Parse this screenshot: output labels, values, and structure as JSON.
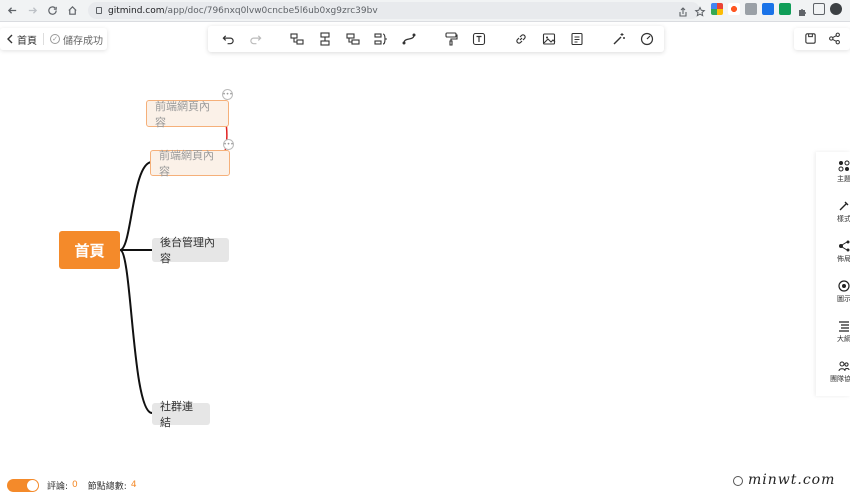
{
  "browser": {
    "url_host": "gitmind.com",
    "url_path": "/app/doc/796nxq0lvw0cncbe5l6ub0xg9zrc39bv"
  },
  "header": {
    "back_label": "首頁",
    "saved_label": "儲存成功"
  },
  "toolbar": {
    "icons": [
      "undo-icon",
      "redo-icon",
      "add-child-icon",
      "add-sibling-icon",
      "add-parent-icon",
      "summary-icon",
      "relation-icon",
      "format-painter-icon",
      "text-icon",
      "link-icon",
      "image-icon",
      "note-icon",
      "magic-icon",
      "theme-icon"
    ]
  },
  "mindmap": {
    "root": "首頁",
    "children": [
      "前端網頁內容",
      "後台管理內容",
      "社群連結"
    ],
    "ghost_node": "前端網頁內容",
    "accent_color": "#f48a2a",
    "relation_color": "#e02020"
  },
  "right_panel": {
    "items": [
      {
        "label": "主題",
        "icon": "theme-icon"
      },
      {
        "label": "樣式",
        "icon": "style-icon"
      },
      {
        "label": "佈局",
        "icon": "layout-icon"
      },
      {
        "label": "圖示",
        "icon": "icon-library-icon"
      },
      {
        "label": "大綱",
        "icon": "outline-icon"
      },
      {
        "label": "團隊協作",
        "icon": "team-icon"
      }
    ]
  },
  "footer": {
    "comment_label": "評論:",
    "comment_count": "0",
    "node_label": "節點總數:",
    "node_count": "4"
  },
  "watermark": "minwt.com"
}
